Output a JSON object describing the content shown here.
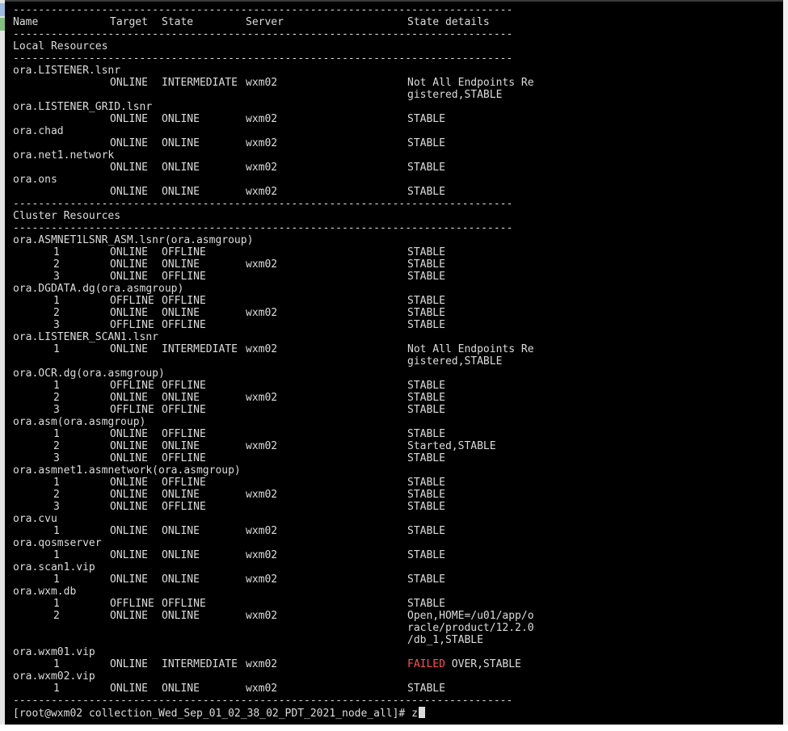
{
  "window": {
    "background": "#000000",
    "text_color": "#dcdcdc",
    "error_color": "#ff5050"
  },
  "separator": "-------------------------------------------------------------------------------",
  "header": {
    "name": "Name",
    "target": "Target",
    "state": "State",
    "server": "Server",
    "details": "State details"
  },
  "sections": [
    {
      "title": "Local Resources",
      "resources": [
        {
          "name": "ora.LISTENER.lsnr",
          "rows": [
            {
              "num": "",
              "target": "ONLINE",
              "state": "INTERMEDIATE",
              "server": "wxm02",
              "details": [
                "Not All Endpoints Re",
                "gistered,STABLE"
              ]
            }
          ]
        },
        {
          "name": "ora.LISTENER_GRID.lsnr",
          "rows": [
            {
              "num": "",
              "target": "ONLINE",
              "state": "ONLINE",
              "server": "wxm02",
              "details": [
                "STABLE"
              ]
            }
          ]
        },
        {
          "name": "ora.chad",
          "rows": [
            {
              "num": "",
              "target": "ONLINE",
              "state": "ONLINE",
              "server": "wxm02",
              "details": [
                "STABLE"
              ]
            }
          ]
        },
        {
          "name": "ora.net1.network",
          "rows": [
            {
              "num": "",
              "target": "ONLINE",
              "state": "ONLINE",
              "server": "wxm02",
              "details": [
                "STABLE"
              ]
            }
          ]
        },
        {
          "name": "ora.ons",
          "rows": [
            {
              "num": "",
              "target": "ONLINE",
              "state": "ONLINE",
              "server": "wxm02",
              "details": [
                "STABLE"
              ]
            }
          ]
        }
      ]
    },
    {
      "title": "Cluster Resources",
      "resources": [
        {
          "name": "ora.ASMNET1LSNR_ASM.lsnr(ora.asmgroup)",
          "rows": [
            {
              "num": "1",
              "target": "ONLINE",
              "state": "OFFLINE",
              "server": "",
              "details": [
                "STABLE"
              ]
            },
            {
              "num": "2",
              "target": "ONLINE",
              "state": "ONLINE",
              "server": "wxm02",
              "details": [
                "STABLE"
              ]
            },
            {
              "num": "3",
              "target": "ONLINE",
              "state": "OFFLINE",
              "server": "",
              "details": [
                "STABLE"
              ]
            }
          ]
        },
        {
          "name": "ora.DGDATA.dg(ora.asmgroup)",
          "rows": [
            {
              "num": "1",
              "target": "OFFLINE",
              "state": "OFFLINE",
              "server": "",
              "details": [
                "STABLE"
              ]
            },
            {
              "num": "2",
              "target": "ONLINE",
              "state": "ONLINE",
              "server": "wxm02",
              "details": [
                "STABLE"
              ]
            },
            {
              "num": "3",
              "target": "OFFLINE",
              "state": "OFFLINE",
              "server": "",
              "details": [
                "STABLE"
              ]
            }
          ]
        },
        {
          "name": "ora.LISTENER_SCAN1.lsnr",
          "rows": [
            {
              "num": "1",
              "target": "ONLINE",
              "state": "INTERMEDIATE",
              "server": "wxm02",
              "details": [
                "Not All Endpoints Re",
                "gistered,STABLE"
              ]
            }
          ]
        },
        {
          "name": "ora.OCR.dg(ora.asmgroup)",
          "rows": [
            {
              "num": "1",
              "target": "OFFLINE",
              "state": "OFFLINE",
              "server": "",
              "details": [
                "STABLE"
              ]
            },
            {
              "num": "2",
              "target": "ONLINE",
              "state": "ONLINE",
              "server": "wxm02",
              "details": [
                "STABLE"
              ]
            },
            {
              "num": "3",
              "target": "OFFLINE",
              "state": "OFFLINE",
              "server": "",
              "details": [
                "STABLE"
              ]
            }
          ]
        },
        {
          "name": "ora.asm(ora.asmgroup)",
          "rows": [
            {
              "num": "1",
              "target": "ONLINE",
              "state": "OFFLINE",
              "server": "",
              "details": [
                "STABLE"
              ]
            },
            {
              "num": "2",
              "target": "ONLINE",
              "state": "ONLINE",
              "server": "wxm02",
              "details": [
                "Started,STABLE"
              ]
            },
            {
              "num": "3",
              "target": "ONLINE",
              "state": "OFFLINE",
              "server": "",
              "details": [
                "STABLE"
              ]
            }
          ]
        },
        {
          "name": "ora.asmnet1.asmnetwork(ora.asmgroup)",
          "rows": [
            {
              "num": "1",
              "target": "ONLINE",
              "state": "OFFLINE",
              "server": "",
              "details": [
                "STABLE"
              ]
            },
            {
              "num": "2",
              "target": "ONLINE",
              "state": "ONLINE",
              "server": "wxm02",
              "details": [
                "STABLE"
              ]
            },
            {
              "num": "3",
              "target": "ONLINE",
              "state": "OFFLINE",
              "server": "",
              "details": [
                "STABLE"
              ]
            }
          ]
        },
        {
          "name": "ora.cvu",
          "rows": [
            {
              "num": "1",
              "target": "ONLINE",
              "state": "ONLINE",
              "server": "wxm02",
              "details": [
                "STABLE"
              ]
            }
          ]
        },
        {
          "name": "ora.qosmserver",
          "rows": [
            {
              "num": "1",
              "target": "ONLINE",
              "state": "ONLINE",
              "server": "wxm02",
              "details": [
                "STABLE"
              ]
            }
          ]
        },
        {
          "name": "ora.scan1.vip",
          "rows": [
            {
              "num": "1",
              "target": "ONLINE",
              "state": "ONLINE",
              "server": "wxm02",
              "details": [
                "STABLE"
              ]
            }
          ]
        },
        {
          "name": "ora.wxm.db",
          "rows": [
            {
              "num": "1",
              "target": "OFFLINE",
              "state": "OFFLINE",
              "server": "",
              "details": [
                "STABLE"
              ]
            },
            {
              "num": "2",
              "target": "ONLINE",
              "state": "ONLINE",
              "server": "wxm02",
              "details": [
                "Open,HOME=/u01/app/o",
                "racle/product/12.2.0",
                "/db_1,STABLE"
              ]
            }
          ]
        },
        {
          "name": "ora.wxm01.vip",
          "rows": [
            {
              "num": "1",
              "target": "ONLINE",
              "state": "INTERMEDIATE",
              "server": "wxm02",
              "details": [
                "FAILED OVER,STABLE"
              ],
              "failed_prefix": "FAILED",
              "details_rest": " OVER,STABLE"
            }
          ]
        },
        {
          "name": "ora.wxm02.vip",
          "rows": [
            {
              "num": "1",
              "target": "ONLINE",
              "state": "ONLINE",
              "server": "wxm02",
              "details": [
                "STABLE"
              ]
            }
          ]
        }
      ]
    }
  ],
  "prompt": {
    "text": "[root@wxm02 collection_Wed_Sep_01_02_38_02_PDT_2021_node_all]# ",
    "input": "z"
  }
}
